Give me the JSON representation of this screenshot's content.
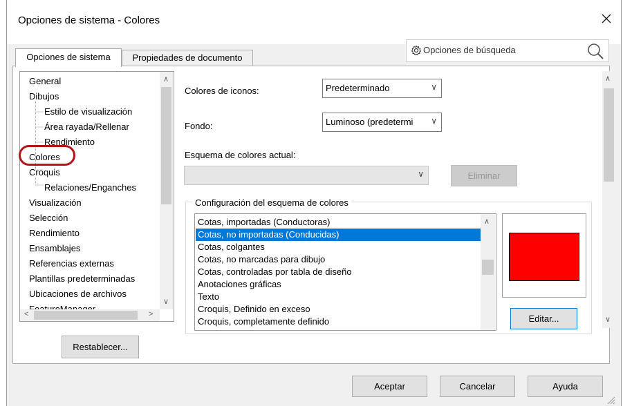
{
  "window": {
    "title": "Opciones de sistema - Colores",
    "close_glyph": "✕"
  },
  "search": {
    "label": "Opciones de búsqueda"
  },
  "tabs": [
    {
      "label": "Opciones de sistema",
      "active": true
    },
    {
      "label": "Propiedades de documento",
      "active": false
    }
  ],
  "tree": {
    "items": [
      {
        "label": "General"
      },
      {
        "label": "Dibujos"
      },
      {
        "label": "Estilo de visualización"
      },
      {
        "label": "Área rayada/Rellenar"
      },
      {
        "label": "Rendimiento"
      },
      {
        "label": "Colores",
        "selected": true
      },
      {
        "label": "Croquis"
      },
      {
        "label": "Relaciones/Enganches"
      },
      {
        "label": "Visualización"
      },
      {
        "label": "Selección"
      },
      {
        "label": "Rendimiento"
      },
      {
        "label": "Ensamblajes"
      },
      {
        "label": "Referencias externas"
      },
      {
        "label": "Plantillas predeterminadas"
      },
      {
        "label": "Ubicaciones de archivos"
      },
      {
        "label": "FeatureManager"
      }
    ]
  },
  "reset_button": {
    "label": "Restablecer..."
  },
  "settings": {
    "icon_colors": {
      "label": "Colores de iconos:",
      "value": "Predeterminado"
    },
    "background": {
      "label": "Fondo:",
      "value": "Luminoso (predetermi"
    },
    "scheme": {
      "label": "Esquema de colores actual:",
      "value": ""
    },
    "delete_button": "Eliminar"
  },
  "scheme_config": {
    "title": "Configuración del esquema de colores",
    "items": [
      {
        "label": "Cotas, importadas (Conductoras)"
      },
      {
        "label": "Cotas, no importadas (Conducidas)",
        "selected": true
      },
      {
        "label": "Cotas, colgantes"
      },
      {
        "label": "Cotas, no marcadas para dibujo"
      },
      {
        "label": "Cotas, controladas por tabla de diseño"
      },
      {
        "label": "Anotaciones gráficas"
      },
      {
        "label": "Texto"
      },
      {
        "label": "Croquis, Definido en exceso"
      },
      {
        "label": "Croquis, completamente definido"
      }
    ],
    "preview_color": "#ff0000",
    "edit_button": "Editar..."
  },
  "footer": {
    "ok": "Aceptar",
    "cancel": "Cancelar",
    "help": "Ayuda"
  },
  "colors": {
    "selection": "#0078d7",
    "highlight_ring": "#b3141b"
  }
}
